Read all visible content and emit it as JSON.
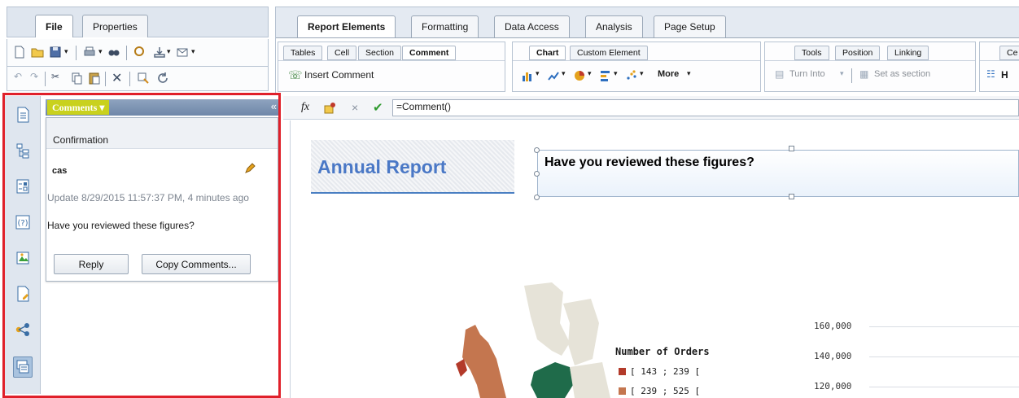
{
  "file_panel": {
    "tabs": [
      {
        "label": "File"
      },
      {
        "label": "Properties"
      }
    ]
  },
  "ribbon": {
    "tabs": [
      {
        "label": "Report Elements"
      },
      {
        "label": "Formatting"
      },
      {
        "label": "Data Access"
      },
      {
        "label": "Analysis"
      },
      {
        "label": "Page Setup"
      }
    ],
    "element_tabs": [
      "Tables",
      "Cell",
      "Section",
      "Comment"
    ],
    "chart_tabs": [
      "Chart",
      "Custom Element"
    ],
    "tools_tabs": [
      "Tools",
      "Position",
      "Linking"
    ],
    "cell_tab_partial": "Ce",
    "insert_comment": "Insert Comment",
    "more": "More",
    "turn_into": "Turn Into",
    "set_as_section": "Set as section",
    "partial_h": "H"
  },
  "formula_bar": {
    "fx": "fx",
    "value": "=Comment()"
  },
  "comments_panel": {
    "title": "Comments",
    "card_title": "Confirmation",
    "author": "cas",
    "meta": "Update 8/29/2015 11:57:37 PM, 4 minutes ago",
    "text": "Have you reviewed these figures?",
    "reply_label": "Reply",
    "copy_label": "Copy Comments..."
  },
  "report": {
    "title": "Annual Report",
    "comment_cell_text": "Have you reviewed these figures?"
  },
  "map_legend": {
    "title": "Number of Orders",
    "items": [
      {
        "label": "[ 143 ; 239 [",
        "color": "#b33a2a"
      },
      {
        "label": "[ 239 ; 525 [",
        "color": "#c4764f"
      }
    ]
  },
  "chart_data": {
    "type": "bar",
    "yticks": [
      "160,000",
      "140,000",
      "120,000"
    ]
  },
  "colors": {
    "highlight": "#e0202a",
    "accent_title": "#4a78c6",
    "comments_header": "#c9d11e"
  }
}
